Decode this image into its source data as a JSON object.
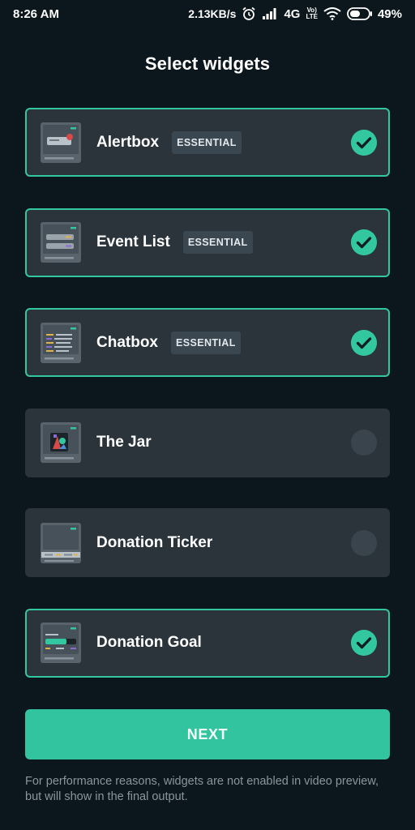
{
  "status_bar": {
    "time": "8:26 AM",
    "speed": "2.13KB/s",
    "network": "4G",
    "volte_top": "Vo)",
    "volte_bottom": "LTE",
    "battery": "49%"
  },
  "title": "Select widgets",
  "widgets": [
    {
      "name": "Alertbox",
      "badge": "ESSENTIAL",
      "selected": true,
      "icon": "alertbox-thumbnail"
    },
    {
      "name": "Event List",
      "badge": "ESSENTIAL",
      "selected": true,
      "icon": "event-list-thumbnail"
    },
    {
      "name": "Chatbox",
      "badge": "ESSENTIAL",
      "selected": true,
      "icon": "chatbox-thumbnail"
    },
    {
      "name": "The Jar",
      "badge": "",
      "selected": false,
      "icon": "jar-thumbnail"
    },
    {
      "name": "Donation Ticker",
      "badge": "",
      "selected": false,
      "icon": "donation-ticker-thumbnail"
    },
    {
      "name": "Donation Goal",
      "badge": "",
      "selected": true,
      "icon": "donation-goal-thumbnail"
    }
  ],
  "next_label": "NEXT",
  "footnote": "For performance reasons, widgets are not enabled in video preview, but will show in the final output.",
  "colors": {
    "background": "#0c171d",
    "card": "#2b343b",
    "accent": "#33c7a0",
    "badge_bg": "#3a4650",
    "unchecked": "#3a444c"
  }
}
